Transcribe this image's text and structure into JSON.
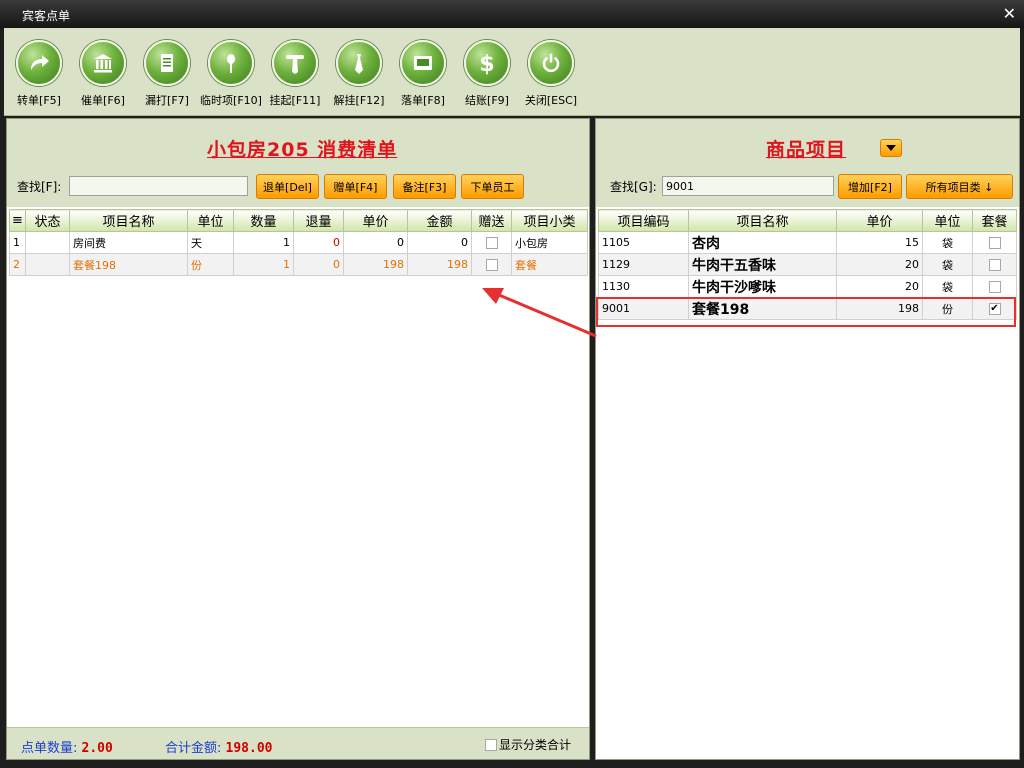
{
  "window": {
    "title": "宾客点单",
    "close_icon": "close-icon"
  },
  "toolbar": [
    {
      "label": "转单[F5]",
      "icon": "forward-arrow-icon"
    },
    {
      "label": "催单[F6]",
      "icon": "bank-icon"
    },
    {
      "label": "漏打[F7]",
      "icon": "document-icon"
    },
    {
      "label": "临时项[F10]",
      "icon": "utensils-icon"
    },
    {
      "label": "挂起[F11]",
      "icon": "hanger-icon"
    },
    {
      "label": "解挂[F12]",
      "icon": "tie-icon"
    },
    {
      "label": "落单[F8]",
      "icon": "monitor-icon"
    },
    {
      "label": "结账[F9]",
      "icon": "dollar-icon"
    },
    {
      "label": "关闭[ESC]",
      "icon": "power-icon"
    }
  ],
  "left_panel": {
    "title": "小包房205 消费清单",
    "search_label": "查找[F]:",
    "search_value": "",
    "buttons": {
      "return": "退单[Del]",
      "gift": "赠单[F4]",
      "note": "备注[F3]",
      "staff": "下单员工"
    },
    "columns": [
      "≡",
      "状态",
      "项目名称",
      "单位",
      "数量",
      "退量",
      "单价",
      "金额",
      "赠送",
      "项目小类"
    ],
    "rows": [
      {
        "no": "1",
        "status": "",
        "name": "房间费",
        "unit": "天",
        "qty": "1",
        "ret": "0",
        "price": "0",
        "amount": "0",
        "gift": false,
        "cat": "小包房"
      },
      {
        "no": "2",
        "status": "",
        "name": "套餐198",
        "unit": "份",
        "qty": "1",
        "ret": "0",
        "price": "198",
        "amount": "198",
        "gift": false,
        "cat": "套餐"
      }
    ],
    "footer": {
      "count_label": "点单数量:",
      "count_value": "2.00",
      "total_label": "合计金额:",
      "total_value": "198.00",
      "show_category_label": "显示分类合计"
    }
  },
  "right_panel": {
    "title": "商品项目",
    "search_label": "查找[G]:",
    "search_value": "9001",
    "buttons": {
      "add": "增加[F2]",
      "all_categories": "所有项目类 ↓"
    },
    "columns": [
      "项目编码",
      "项目名称",
      "单价",
      "单位",
      "套餐"
    ],
    "rows": [
      {
        "code": "1105",
        "name": "杏肉",
        "price": "15",
        "unit": "袋",
        "set": false
      },
      {
        "code": "1129",
        "name": "牛肉干五香味",
        "price": "20",
        "unit": "袋",
        "set": false
      },
      {
        "code": "1130",
        "name": "牛肉干沙嗲味",
        "price": "20",
        "unit": "袋",
        "set": false
      },
      {
        "code": "9001",
        "name": "套餐198",
        "price": "198",
        "unit": "份",
        "set": true
      }
    ]
  },
  "colors": {
    "accent": "#e0141c",
    "toolbar_bg": "#d9e2c6",
    "button_orange": "#ff9c00",
    "footer_blue": "#1b3fd0"
  }
}
